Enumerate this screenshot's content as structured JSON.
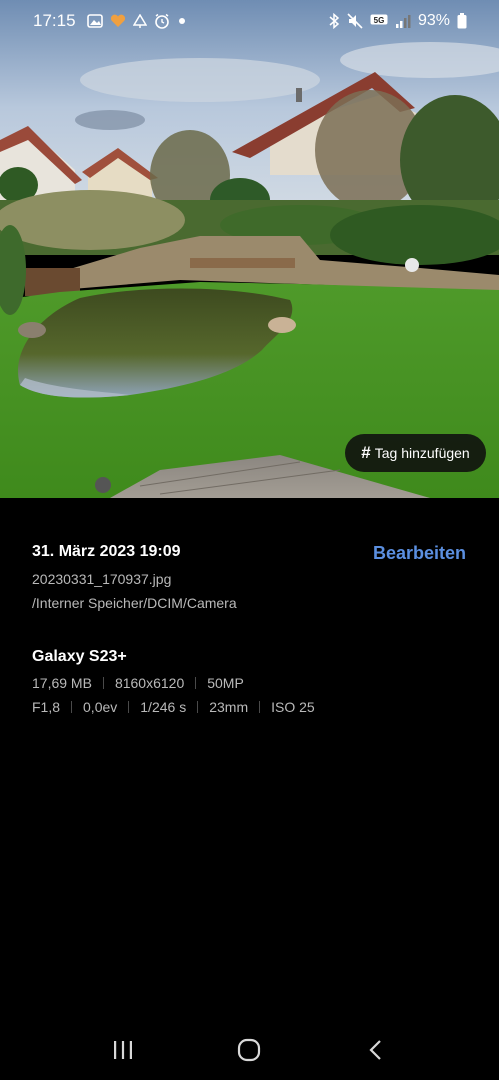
{
  "status_bar": {
    "time": "17:15",
    "notification_icons": [
      "image-icon",
      "heart-icon",
      "tree-icon",
      "alarm-icon",
      "dot-icon"
    ],
    "system_icons": [
      "bluetooth-icon",
      "mute-icon",
      "5g-icon",
      "signal-icon",
      "battery-icon"
    ],
    "network": "5G",
    "battery": "93%"
  },
  "photo": {
    "tag_button_label": "Tag hinzufügen"
  },
  "details": {
    "date": "31. März 2023 19:09",
    "edit_label": "Bearbeiten",
    "filename": "20230331_170937.jpg",
    "path": "/Interner Speicher/DCIM/Camera",
    "device": "Galaxy S23+",
    "size": "17,69 MB",
    "resolution": "8160x6120",
    "megapixels": "50MP",
    "aperture": "F1,8",
    "exposure_value": "0,0ev",
    "shutter": "1/246 s",
    "focal_length": "23mm",
    "iso": "ISO 25"
  },
  "colors": {
    "accent": "#5b8fe0",
    "background": "#000000",
    "secondary_text": "#b9b9b9"
  }
}
